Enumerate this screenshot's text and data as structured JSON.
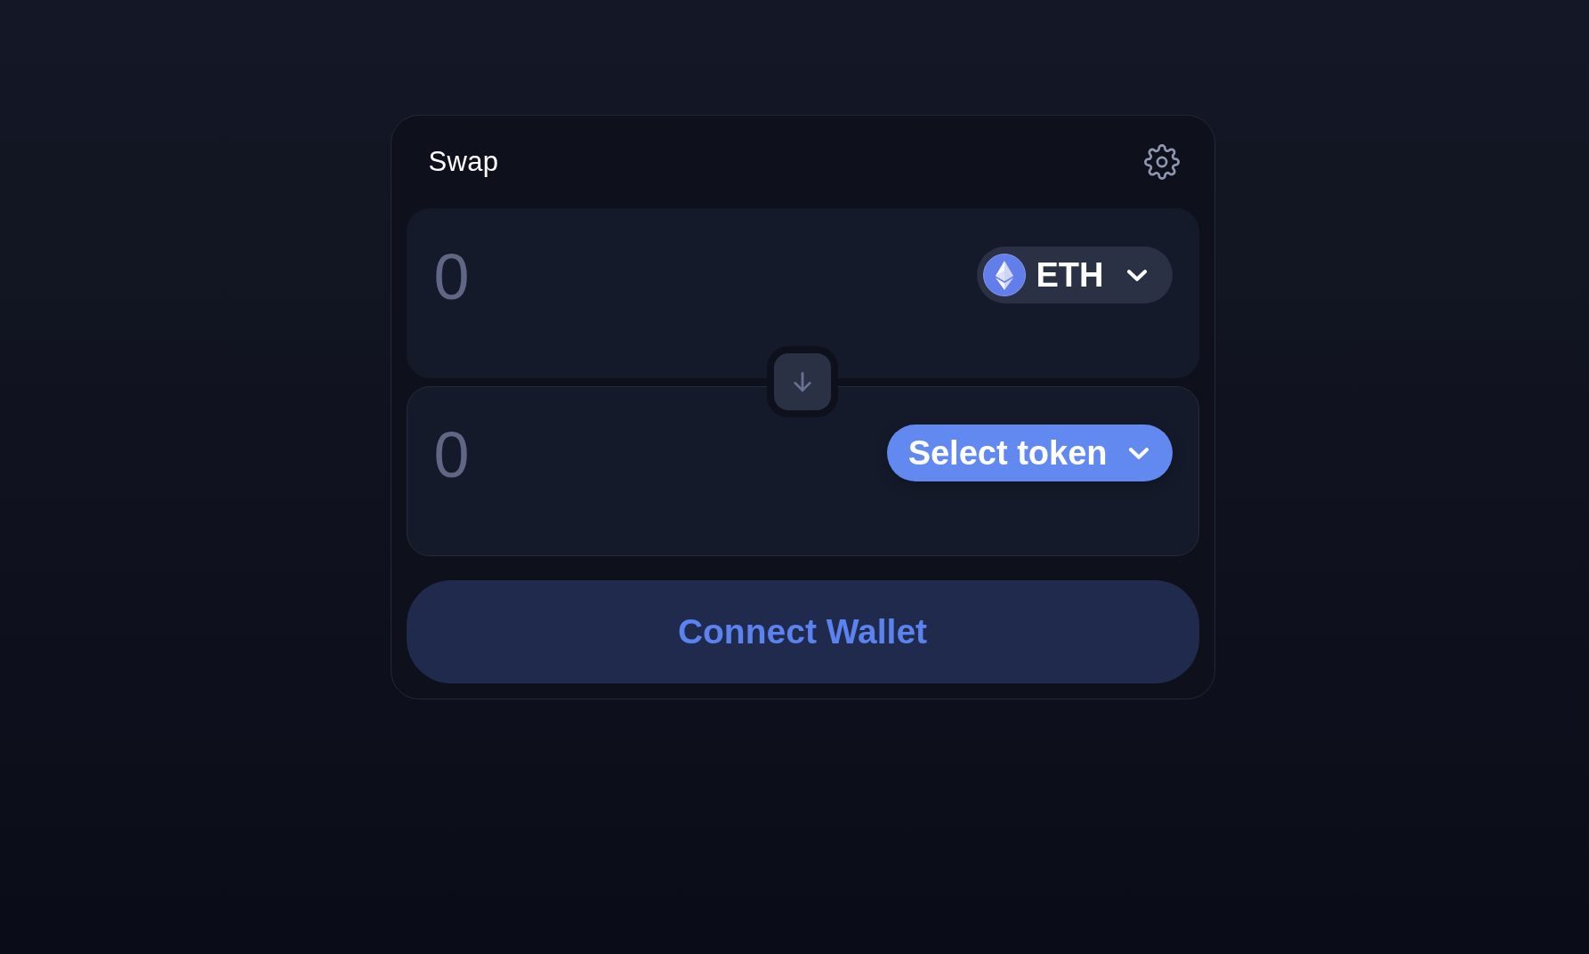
{
  "header": {
    "title": "Swap"
  },
  "panels": [
    {
      "amount": {
        "placeholder": "0"
      },
      "token_button": {
        "kind": "token",
        "label": "ETH"
      }
    },
    {
      "amount": {
        "placeholder": "0"
      },
      "token_button": {
        "kind": "select",
        "label": "Select token"
      }
    }
  ],
  "connect_button": {
    "label": "Connect Wallet"
  }
}
